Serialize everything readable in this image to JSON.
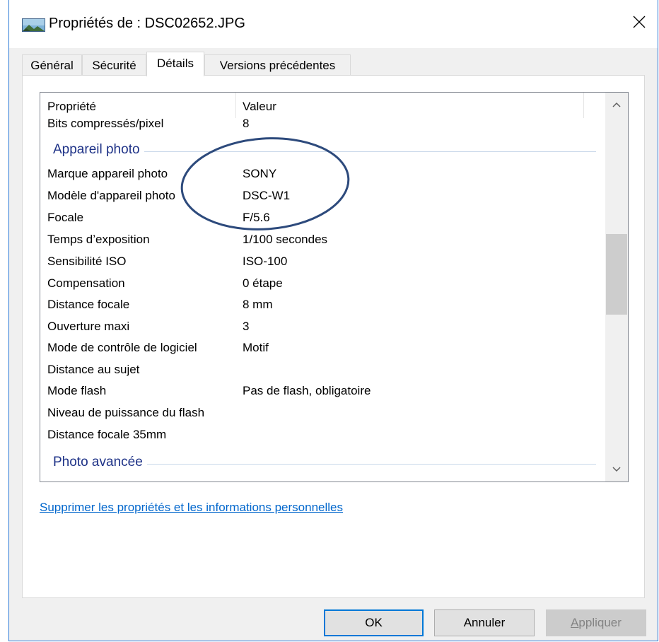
{
  "window": {
    "title": "Propriétés de : DSC02652.JPG",
    "close_glyph": "✕"
  },
  "tabs": [
    {
      "label": "Général",
      "active": false
    },
    {
      "label": "Sécurité",
      "active": false
    },
    {
      "label": "Détails",
      "active": true
    },
    {
      "label": "Versions précédentes",
      "active": false
    }
  ],
  "details": {
    "col_property": "Propriété",
    "col_value": "Valeur",
    "rows_top": [
      {
        "property": "Bits compressés/pixel",
        "value": "8"
      }
    ],
    "group_camera": "Appareil photo",
    "camera_rows": [
      {
        "property": "Marque appareil photo",
        "value": "SONY"
      },
      {
        "property": "Modèle d'appareil photo",
        "value": "DSC-W1"
      },
      {
        "property": "Focale",
        "value": "F/5.6"
      },
      {
        "property": "Temps d’exposition",
        "value": "1/100 secondes"
      },
      {
        "property": "Sensibilité ISO",
        "value": "ISO-100"
      },
      {
        "property": "Compensation",
        "value": "0 étape"
      },
      {
        "property": "Distance focale",
        "value": "8 mm"
      },
      {
        "property": "Ouverture maxi",
        "value": "3"
      },
      {
        "property": "Mode de contrôle de logiciel",
        "value": "Motif"
      },
      {
        "property": "Distance au sujet",
        "value": ""
      },
      {
        "property": "Mode flash",
        "value": "Pas de flash, obligatoire"
      },
      {
        "property": "Niveau de puissance du flash",
        "value": ""
      },
      {
        "property": "Distance focale 35mm",
        "value": ""
      }
    ],
    "group_advanced": "Photo avancée"
  },
  "link_remove": "Supprimer les propriétés et les informations personnelles",
  "buttons": {
    "ok": "OK",
    "cancel": "Annuler",
    "apply_prefix": "A",
    "apply_rest": "ppliquer"
  },
  "colors": {
    "window_border": "#2b79d7",
    "group_title": "#1e3287",
    "link": "#0066cc",
    "annotation": "#2d4a7c"
  },
  "icons": {
    "title": "image-file-icon",
    "close": "close-icon",
    "scroll_up": "chevron-up-icon",
    "scroll_down": "chevron-down-icon"
  }
}
